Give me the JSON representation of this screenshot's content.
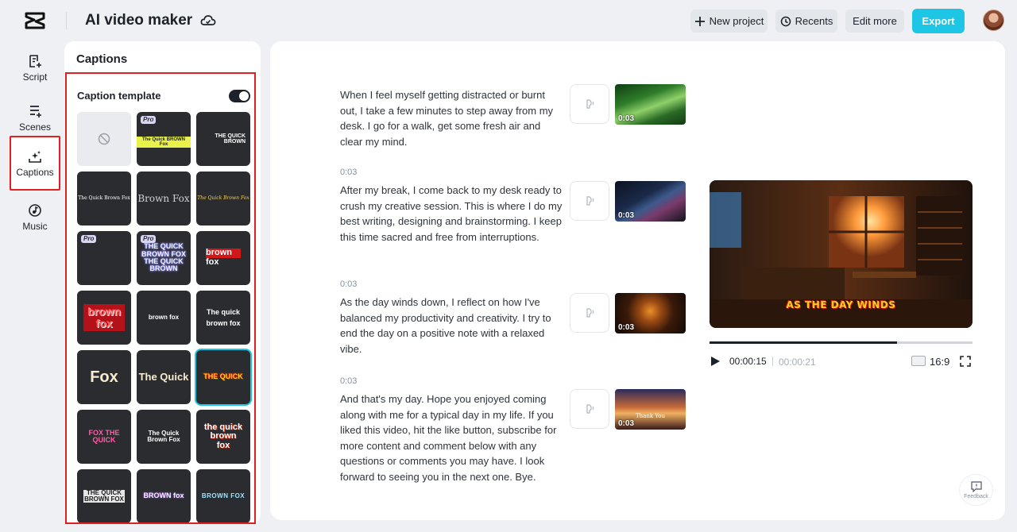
{
  "app": {
    "title": "AI video maker"
  },
  "toolbar": {
    "new_project": "New project",
    "recents": "Recents",
    "edit_more": "Edit more",
    "export": "Export"
  },
  "rail": {
    "items": [
      {
        "label": "Script",
        "icon": "script-icon"
      },
      {
        "label": "Scenes",
        "icon": "scenes-icon"
      },
      {
        "label": "Captions",
        "icon": "captions-icon",
        "active": true
      },
      {
        "label": "Music",
        "icon": "music-icon"
      }
    ]
  },
  "captions_panel": {
    "title": "Captions",
    "template_label": "Caption template",
    "template_enabled": true,
    "pro_badge": "Pro",
    "templates": [
      {
        "kind": "none"
      },
      {
        "text": "The Quick BROWN Fox",
        "pro": true
      },
      {
        "text": "THE QUICK BROWN"
      },
      {
        "text": "The Quick Brown Fox"
      },
      {
        "text": "Brown Fox"
      },
      {
        "text": "The Quick Brown Fox"
      },
      {
        "text": "",
        "pro": true
      },
      {
        "text": "THE QUICK BROWN FOX THE QUICK BROWN",
        "pro": true
      },
      {
        "text": "brown fox"
      },
      {
        "text": "brown fox"
      },
      {
        "text": "brown fox"
      },
      {
        "text": "The quick brown fox"
      },
      {
        "text": "Fox"
      },
      {
        "text": "The Quick"
      },
      {
        "text": "THE QUICK",
        "selected": true
      },
      {
        "text": "FOX THE QUICK"
      },
      {
        "text": "The Quick Brown Fox"
      },
      {
        "text": "the quick brown fox"
      },
      {
        "text": "THE QUICK BROWN FOX"
      },
      {
        "text": "BROWN fox"
      },
      {
        "text": "BROWN FOX"
      }
    ]
  },
  "scenes": [
    {
      "time": "",
      "text": "When I feel myself getting distracted or burnt out, I take a few minutes to step away from my desk. I go for a walk, get some fresh air and clear my mind.",
      "duration": "0:03"
    },
    {
      "time": "0:03",
      "text": "After my break, I come back to my desk ready to crush my creative session. This is where I do my best writing, designing and brainstorming. I keep this time sacred and free from interruptions.",
      "duration": "0:03"
    },
    {
      "time": "0:03",
      "text": "As the day winds down, I reflect on how I've balanced my productivity and creativity. I try to end the day on a positive note with a relaxed vibe.",
      "duration": "0:03"
    },
    {
      "time": "0:03",
      "text": "And that's my day. Hope you enjoyed coming along with me for a typical day in my life. If you liked this video, hit the like button, subscribe for more content and comment below with any questions or comments you may have. I look forward to seeing you in the next one. Bye.",
      "duration": "0:03",
      "thumb_caption": "Thank You"
    }
  ],
  "player": {
    "caption": "AS THE DAY WINDS",
    "current_time": "00:00:15",
    "total_time": "00:00:21",
    "progress": 0.714,
    "aspect_ratio": "16:9"
  },
  "feedback": {
    "label": "Feedback"
  },
  "colors": {
    "accent": "#1ec6e6",
    "highlight": "#e02020"
  }
}
